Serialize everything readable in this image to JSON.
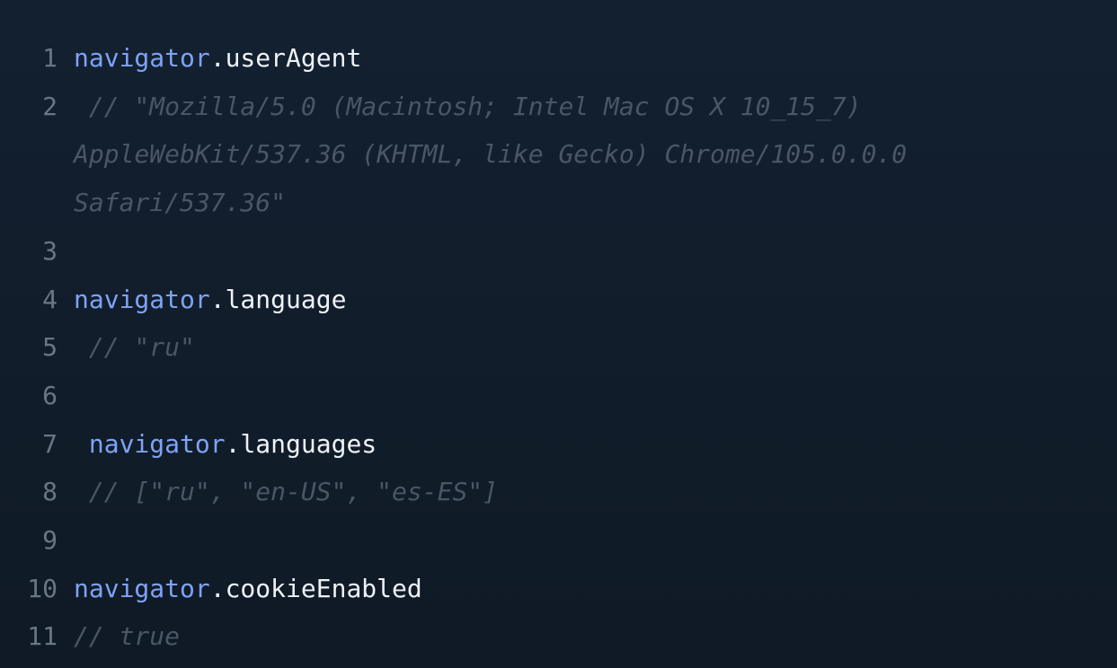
{
  "colors": {
    "background": "#111b27",
    "keyword": "#7ea3f5",
    "property": "#eef2f6",
    "comment": "#4a5665",
    "line_number": "#6b7684"
  },
  "lines": [
    {
      "number": "1",
      "object": "navigator",
      "dot": ".",
      "property": "userAgent"
    },
    {
      "number": "2",
      "comment_l1": " // \"Mozilla/5.0 (Macintosh; Intel Mac OS X 10_15_7)",
      "comment_l2": "AppleWebKit/537.36 (KHTML, like Gecko) Chrome/105.0.0.0",
      "comment_l3": "Safari/537.36\""
    },
    {
      "number": "3"
    },
    {
      "number": "4",
      "object": "navigator",
      "dot": ".",
      "property": "language"
    },
    {
      "number": "5",
      "comment": " // \"ru\""
    },
    {
      "number": "6"
    },
    {
      "number": "7",
      "object": " navigator",
      "dot": ".",
      "property": "languages"
    },
    {
      "number": "8",
      "comment": " // [\"ru\", \"en-US\", \"es-ES\"]"
    },
    {
      "number": "9"
    },
    {
      "number": "10",
      "object": "navigator",
      "dot": ".",
      "property": "cookieEnabled"
    },
    {
      "number": "11",
      "comment": "// true"
    }
  ]
}
